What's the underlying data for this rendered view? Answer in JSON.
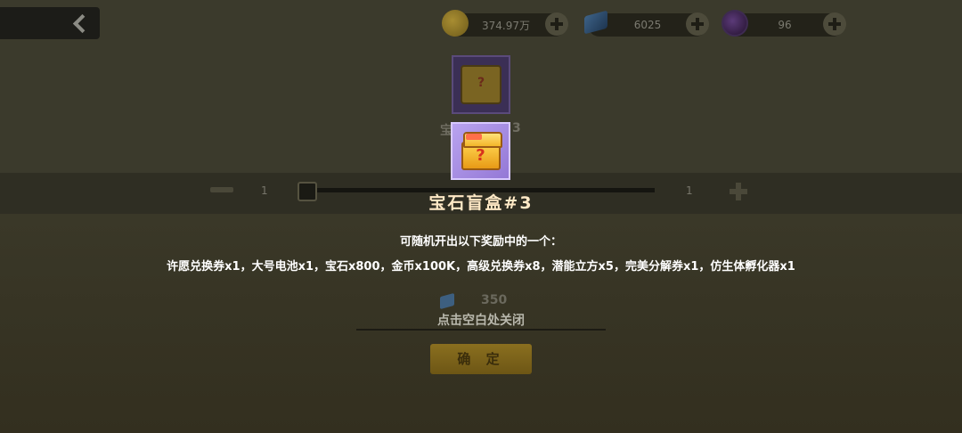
{
  "header": {
    "resources": [
      {
        "icon": "gold-coin-icon",
        "value": "374.97万"
      },
      {
        "icon": "blue-gem-icon",
        "value": "6025"
      },
      {
        "icon": "purple-orb-icon",
        "value": "96"
      }
    ]
  },
  "background": {
    "item_name_left": "宝",
    "item_name_right": "3",
    "slider": {
      "left_value": "1",
      "right_value": "1"
    },
    "cost_value": "350",
    "confirm_label": "确 定"
  },
  "popup": {
    "title": "宝石盲盒#3",
    "subtitle": "可随机开出以下奖励中的一个：",
    "rewards": "许愿兑换券x1，大号电池x1，宝石x800，金币x100K，高级兑换券x8，潜能立方x5，完美分解券x1，仿生体孵化器x1",
    "close_hint": "点击空白处关闭",
    "item_icon_mark": "?"
  }
}
